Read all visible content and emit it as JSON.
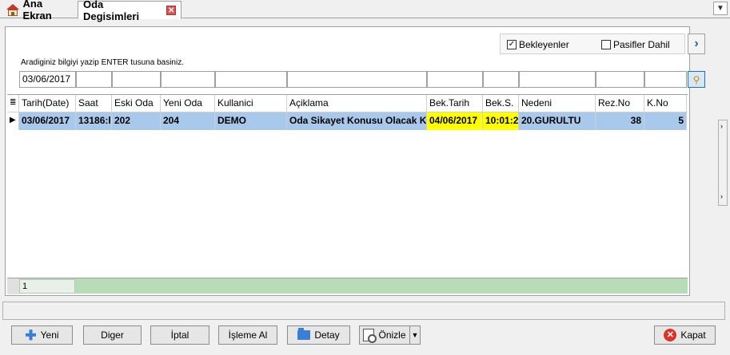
{
  "tabs": [
    {
      "label": "Ana Ekran",
      "active": false
    },
    {
      "label": "Oda Degisimleri",
      "active": true
    }
  ],
  "filters": {
    "bekleyenler": {
      "label": "Bekleyenler",
      "checked": true
    },
    "pasifler": {
      "label": "Pasifler Dahil",
      "checked": false
    }
  },
  "search": {
    "hint": "Aradiginiz bilgiyi yazip ENTER tusuna basiniz.",
    "date_value": "03/06/2017"
  },
  "grid": {
    "columns": [
      "Tarih(Date)",
      "Saat",
      "Eski Oda",
      "Yeni Oda",
      "Kullanici",
      "Açiklama",
      "Bek.Tarih",
      "Bek.S.",
      "Nedeni",
      "Rez.No",
      "K.No"
    ],
    "rows": [
      [
        "03/06/2017",
        "13186:l",
        "202",
        "204",
        "DEMO",
        "Oda Sikayet Konusu Olacak Ka",
        "04/06/2017",
        "10:01:2",
        "20.GURULTU",
        "38",
        "5"
      ]
    ],
    "footer_count": "1"
  },
  "buttons": {
    "yeni": "Yeni",
    "diger": "Diger",
    "iptal": "İptal",
    "isleme_al": "İşleme Al",
    "detay": "Detay",
    "onizle": "Önizle",
    "kapat": "Kapat"
  },
  "colors": {
    "row_selected": "#a8c8ec",
    "highlight": "#ffff00",
    "footer": "#b8dcb8"
  }
}
